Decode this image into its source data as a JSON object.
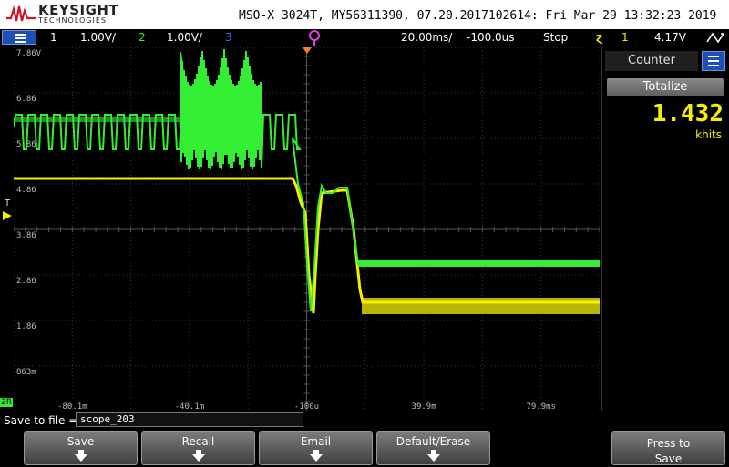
{
  "header": {
    "brand": "KEYSIGHT",
    "brand_sub": "TECHNOLOGIES",
    "model_line": "MSO-X 3024T, MY56311390, 07.20.2017102614: Fri Mar 29 13:32:23 2019"
  },
  "status_bar": {
    "ch1_num": "1",
    "ch1_scale": "1.00V/",
    "ch2_num": "2",
    "ch2_scale": "1.00V/",
    "ch3_num": "3",
    "timebase": "20.00ms/",
    "delay": "-100.0us",
    "run_state": "Stop",
    "trigger_symbol": "ɀ",
    "trigger_source": "1",
    "trigger_level": "4.17V",
    "colors": {
      "ch1": "#f5f000",
      "ch2": "#33ee33",
      "ch3": "#4a6cff",
      "trigger_marker": "#e63ce6"
    }
  },
  "graticule": {
    "volt_labels": [
      "7.86V",
      "6.86",
      "5.86",
      "4.86",
      "3.86",
      "2.86",
      "1.86",
      "863m"
    ],
    "time_labels": [
      "-80.1m",
      "-40.1m",
      "-100u",
      "39.9m",
      "79.9ms"
    ],
    "trigger_level_label": "T",
    "ch2_ground_label": "2R",
    "grid_color": "#3a3a3a"
  },
  "sidebar": {
    "counter_tab": "Counter",
    "totalize_label": "Totalize",
    "counter_value": "1.432",
    "counter_unit": "khits"
  },
  "bottom": {
    "save_label": "Save to file =",
    "save_filename": "scope_203",
    "softkeys": [
      {
        "label": "Save",
        "arrow": true
      },
      {
        "label": "Recall",
        "arrow": true
      },
      {
        "label": "Email",
        "arrow": true
      },
      {
        "label": "Default/Erase",
        "arrow": true
      },
      {
        "label": "Press to Save",
        "arrow": false
      }
    ]
  }
}
